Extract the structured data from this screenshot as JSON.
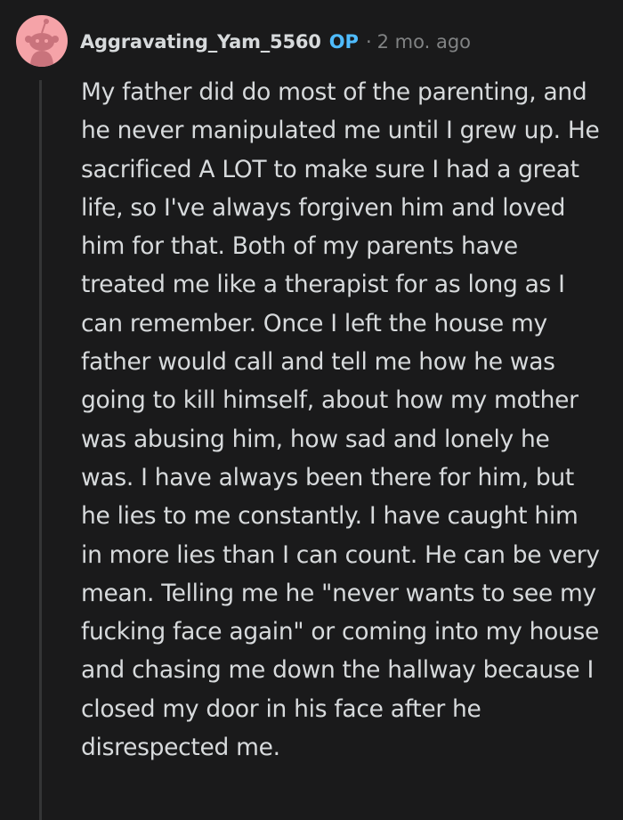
{
  "comment": {
    "author": "Aggravating_Yam_5560",
    "op_badge": "OP",
    "separator": "·",
    "timestamp": "2 mo. ago",
    "avatar_icon": "snoo-avatar-icon",
    "avatar_color": "#f5a3a8",
    "body": "My father did do most of the parenting, and he never manipulated me until I grew up. He sacrificed A LOT to make sure I had a great life, so I've always forgiven him and loved him for that. Both of my parents have treated me like a therapist for as long as I can remember. Once I left the house my father would call and tell me how he was going to kill himself, about how my mother was abusing him, how sad and lonely he was. I have always been there for him, but he lies to me constantly. I have caught him in more lies than I can count. He can be very mean. Telling me he \"never wants to see my fucking face again\" or coming into my house and chasing me down the hallway because I closed my door in his face after he disrespected me."
  },
  "colors": {
    "background": "#1a1a1b",
    "text": "#d7dadc",
    "meta": "#818384",
    "op": "#4fbcff",
    "thread_line": "#343536"
  }
}
